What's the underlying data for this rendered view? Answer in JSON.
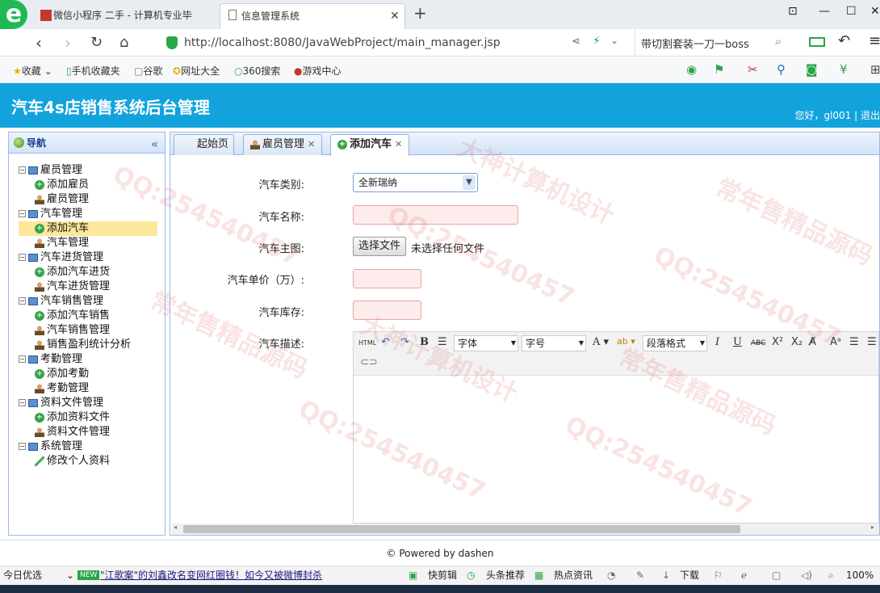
{
  "browser": {
    "tabs": [
      {
        "title": "微信小程序 二手 - 计算机专业毕"
      },
      {
        "title": "信息管理系统"
      }
    ],
    "url": "http://localhost:8080/JavaWebProject/main_manager.jsp",
    "search_text": "带切割套装一刀一boss",
    "bookmarks": [
      "收藏",
      "手机收藏夹",
      "谷歌",
      "网址大全",
      "360搜索",
      "游戏中心"
    ]
  },
  "app": {
    "title": "汽车4s店销售系统后台管理",
    "greeting": "您好，gl001 | 退出"
  },
  "sidebar": {
    "title": "导航",
    "groups": [
      {
        "label": "雇员管理",
        "items": [
          "添加雇员",
          "雇员管理"
        ]
      },
      {
        "label": "汽车管理",
        "items": [
          "添加汽车",
          "汽车管理"
        ]
      },
      {
        "label": "汽车进货管理",
        "items": [
          "添加汽车进货",
          "汽车进货管理"
        ]
      },
      {
        "label": "汽车销售管理",
        "items": [
          "添加汽车销售",
          "汽车销售管理",
          "销售盈利统计分析"
        ]
      },
      {
        "label": "考勤管理",
        "items": [
          "添加考勤",
          "考勤管理"
        ]
      },
      {
        "label": "资料文件管理",
        "items": [
          "添加资料文件",
          "资料文件管理"
        ]
      },
      {
        "label": "系统管理",
        "items": [
          "修改个人资料"
        ]
      }
    ]
  },
  "tabs": [
    "起始页",
    "雇员管理",
    "添加汽车"
  ],
  "form": {
    "category_label": "汽车类别:",
    "category_value": "全新瑞纳",
    "name_label": "汽车名称:",
    "image_label": "汽车主图:",
    "file_button": "选择文件",
    "file_status": "未选择任何文件",
    "price_label": "汽车单价（万）:",
    "stock_label": "汽车库存:",
    "desc_label": "汽车描述:"
  },
  "editor": {
    "html": "HTML",
    "font": "字体",
    "size": "字号",
    "paragraph": "段落格式"
  },
  "footer": "© Powered by dashen",
  "statusbar": {
    "left": "今日优选",
    "news_badge": "NEW",
    "news": "\"江歌案\"的刘鑫改名变网红圈钱！如今又被微博封杀",
    "items": [
      "快剪辑",
      "头条推荐",
      "热点资讯",
      "下载"
    ],
    "zoom": "100%"
  },
  "watermarks": [
    "QQ:254540457",
    "大神计算机设计",
    "常年售精品源码"
  ]
}
